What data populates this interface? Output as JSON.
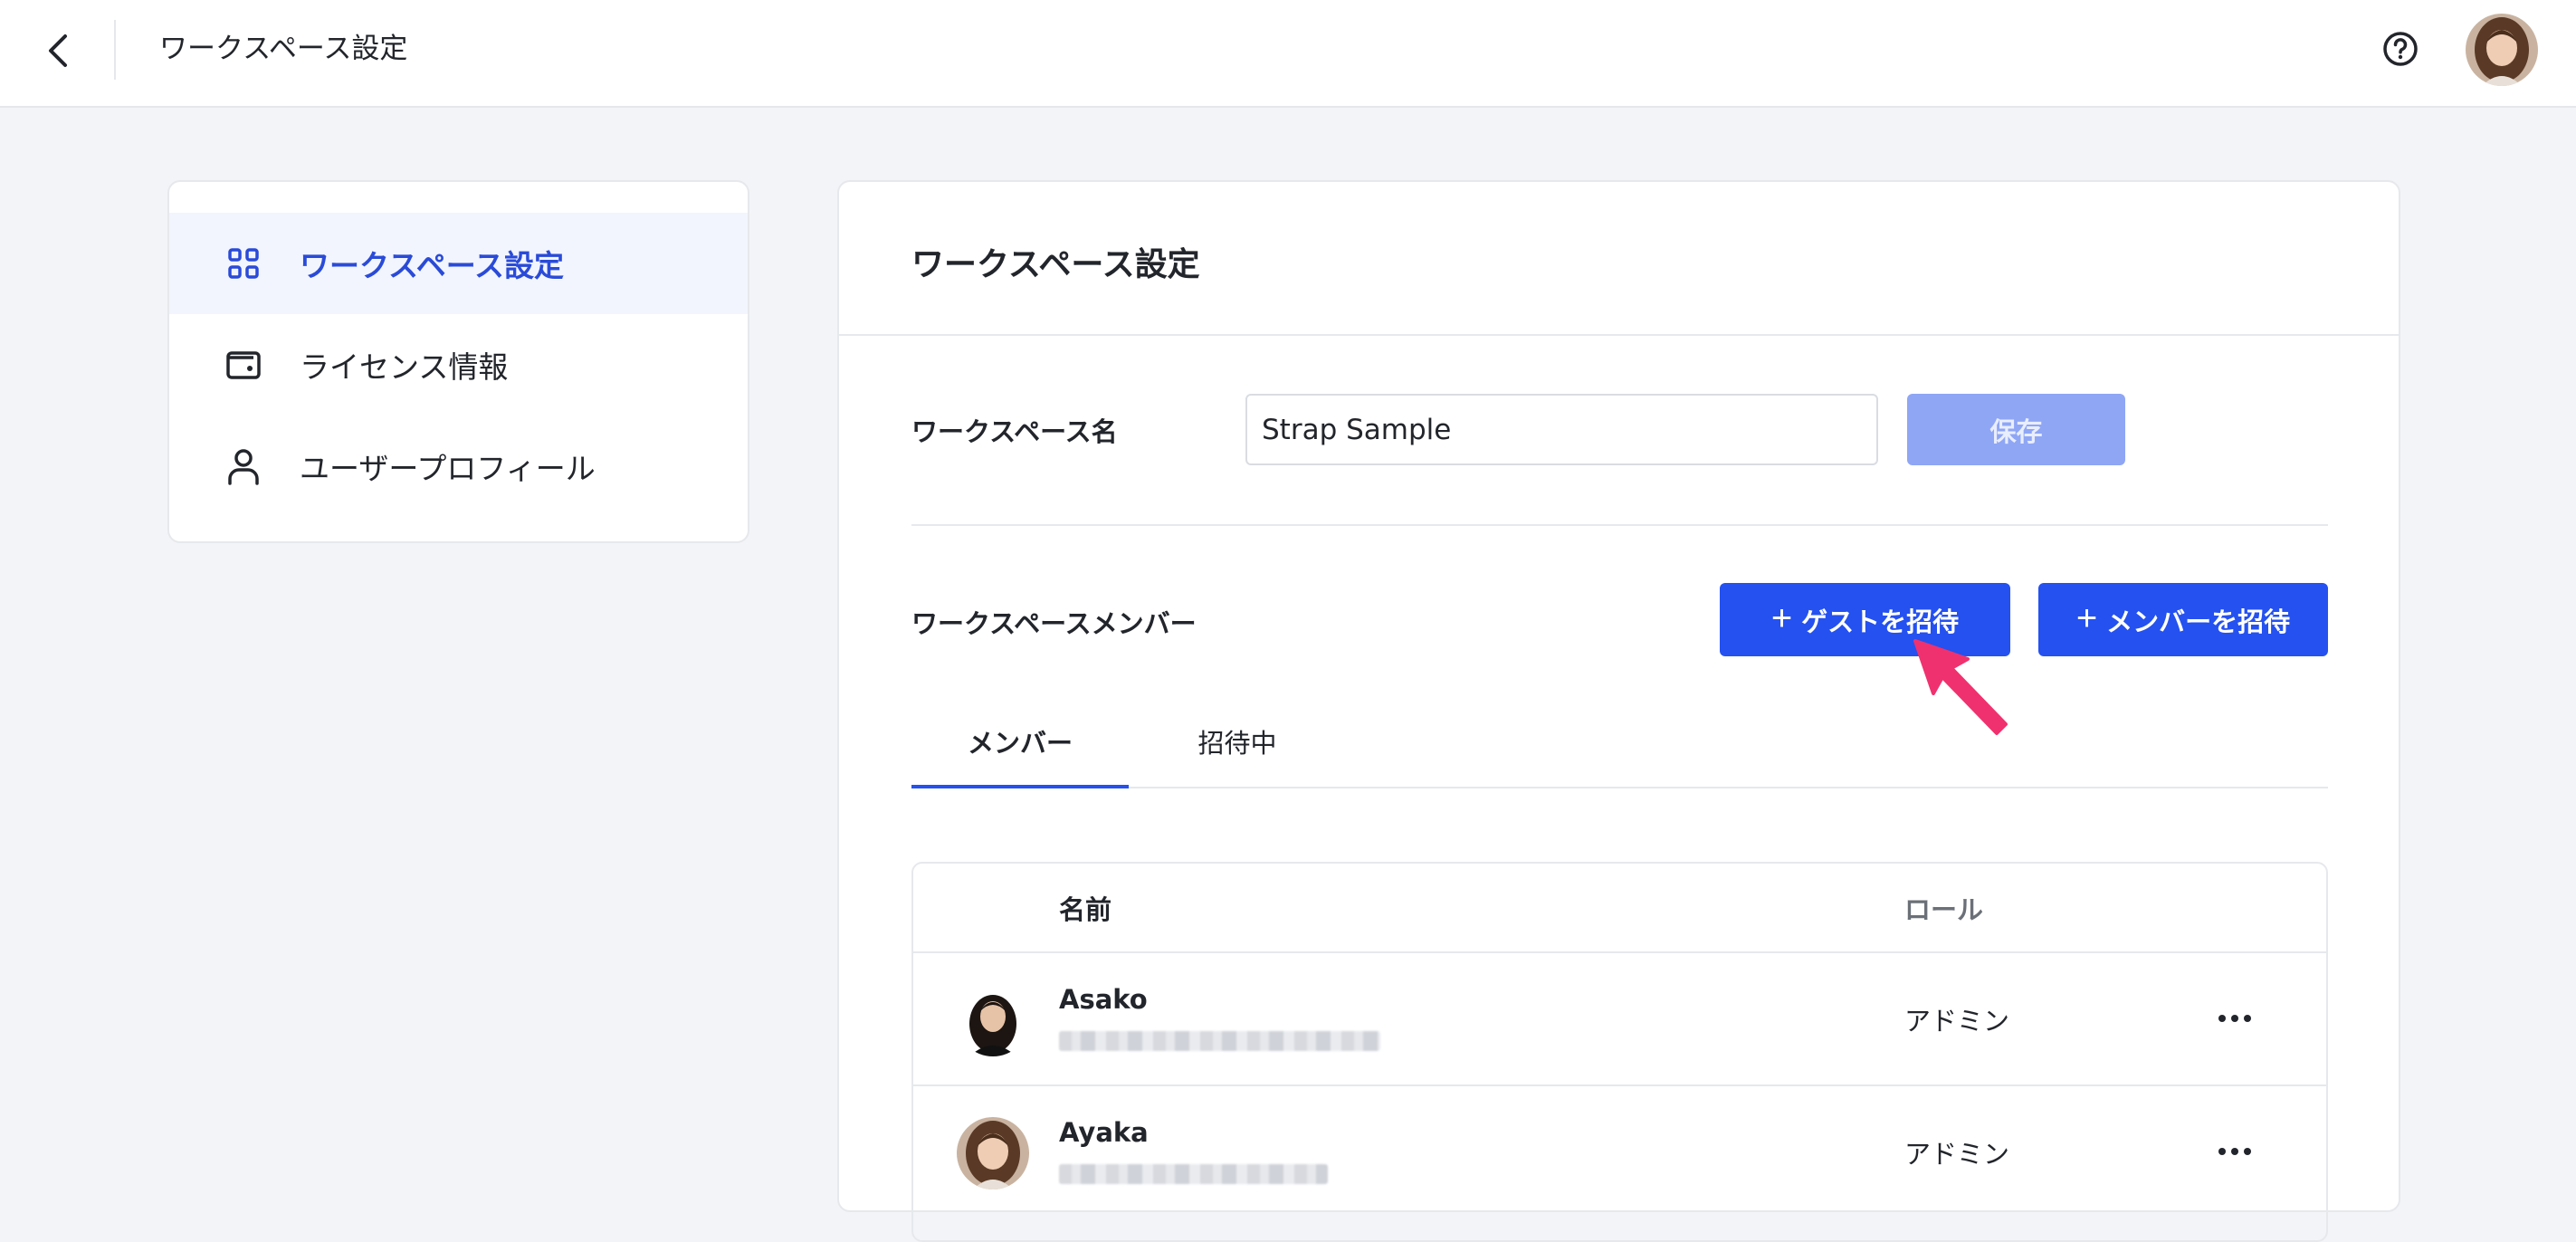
{
  "topbar": {
    "title": "ワークスペース設定",
    "back_icon": "chevron-left-icon",
    "help_icon": "question-circle-icon"
  },
  "sidebar": {
    "items": [
      {
        "label": "ワークスペース設定",
        "icon": "grid-icon",
        "active": true
      },
      {
        "label": "ライセンス情報",
        "icon": "wallet-icon",
        "active": false
      },
      {
        "label": "ユーザープロフィール",
        "icon": "user-icon",
        "active": false
      }
    ]
  },
  "main": {
    "title": "ワークスペース設定",
    "workspace_name_label": "ワークスペース名",
    "workspace_name_value": "Strap Sample",
    "save_label": "保存",
    "members_label": "ワークスペースメンバー",
    "invite_guest_label": "ゲストを招待",
    "invite_member_label": "メンバーを招待",
    "tabs": [
      {
        "label": "メンバー",
        "active": true
      },
      {
        "label": "招待中",
        "active": false
      }
    ],
    "table": {
      "columns": {
        "name": "名前",
        "role": "ロール"
      },
      "rows": [
        {
          "name": "Asako",
          "role": "アドミン"
        },
        {
          "name": "Ayaka",
          "role": "アドミン"
        }
      ]
    }
  },
  "colors": {
    "accent": "#2451f0",
    "accent_disabled": "#8fa6f5",
    "active_nav_text": "#2a4bd8",
    "annotation_arrow": "#f0316f"
  }
}
